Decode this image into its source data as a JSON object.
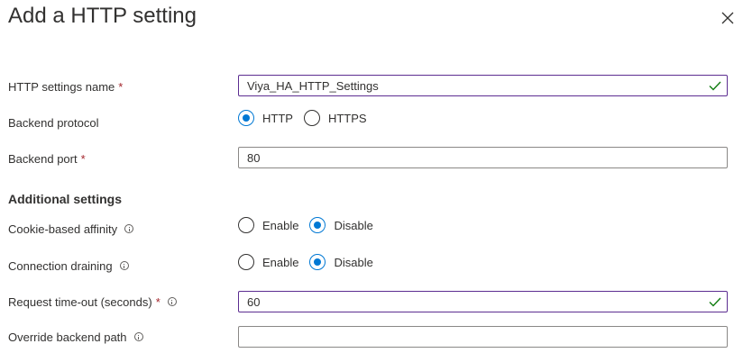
{
  "dialog": {
    "title": "Add a HTTP setting",
    "close_icon": "close-icon"
  },
  "form": {
    "settings_name": {
      "label": "HTTP settings name",
      "required_mark": "*",
      "value": "Viya_HA_HTTP_Settings",
      "status_icon": "checkmark-icon"
    },
    "backend_protocol": {
      "label": "Backend protocol",
      "options": [
        "HTTP",
        "HTTPS"
      ],
      "selected": "HTTP"
    },
    "backend_port": {
      "label": "Backend port",
      "required_mark": "*",
      "value": "80"
    },
    "additional_heading": "Additional settings",
    "cookie_affinity": {
      "label": "Cookie-based affinity",
      "info_icon": "info-icon",
      "options": [
        "Enable",
        "Disable"
      ],
      "selected": "Disable"
    },
    "connection_draining": {
      "label": "Connection draining",
      "info_icon": "info-icon",
      "options": [
        "Enable",
        "Disable"
      ],
      "selected": "Disable"
    },
    "request_timeout": {
      "label": "Request time-out (seconds)",
      "required_mark": "*",
      "info_icon": "info-icon",
      "value": "60",
      "status_icon": "checkmark-icon"
    },
    "override_path": {
      "label": "Override backend path",
      "info_icon": "info-icon",
      "value": ""
    }
  },
  "colors": {
    "accent": "#0078d4",
    "valid_border": "#5c2d91",
    "valid_check": "#107c10",
    "required": "#a4262c"
  }
}
